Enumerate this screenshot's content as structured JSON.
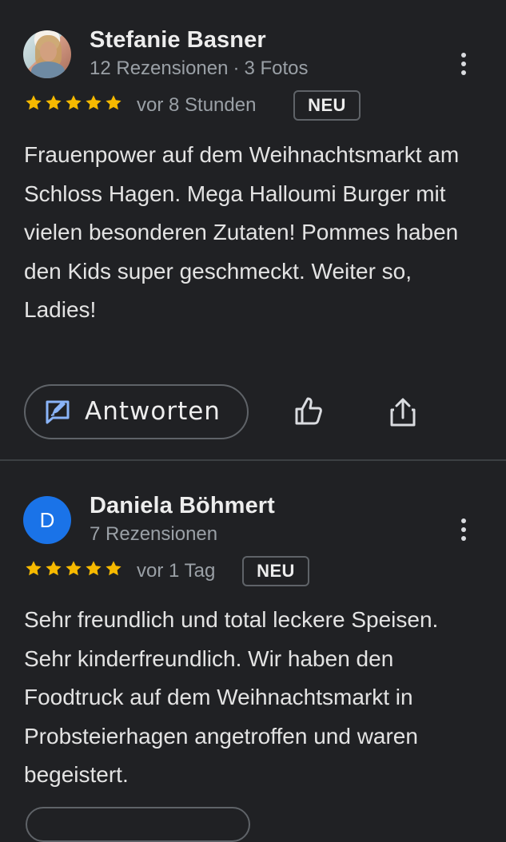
{
  "reviews": [
    {
      "author": "Stefanie Basner",
      "reviews_count": "12 Rezensionen",
      "separator": "·",
      "photos": "3 Fotos",
      "rating": 5,
      "time": "vor 8 Stunden",
      "badge": "NEU",
      "text": "Frauenpower auf dem Weihnachtsmarkt am Schloss Hagen. Mega Halloumi Burger mit vielen besonderen Zutaten! Pommes haben den Kids super geschmeckt. Weiter so, Ladies!",
      "reply_label": "Antworten",
      "avatar": "photo"
    },
    {
      "author": "Daniela Böhmert",
      "avatar_letter": "D",
      "reviews_count": "7 Rezensionen",
      "rating": 5,
      "time": "vor 1 Tag",
      "badge": "NEU",
      "text": "Sehr freundlich und total leckere Speisen. Sehr kinderfreundlich. Wir haben den Foodtruck auf dem Weihnachtsmarkt in Probsteierhagen angetroffen und waren begeistert."
    }
  ],
  "colors": {
    "background": "#202124",
    "star": "#f6b900",
    "accent": "#8ab4f8",
    "avatar_blue": "#1a73e8"
  },
  "icons": [
    "more-vert-icon",
    "star-icon",
    "reply-icon",
    "thumb-up-icon",
    "share-icon"
  ]
}
